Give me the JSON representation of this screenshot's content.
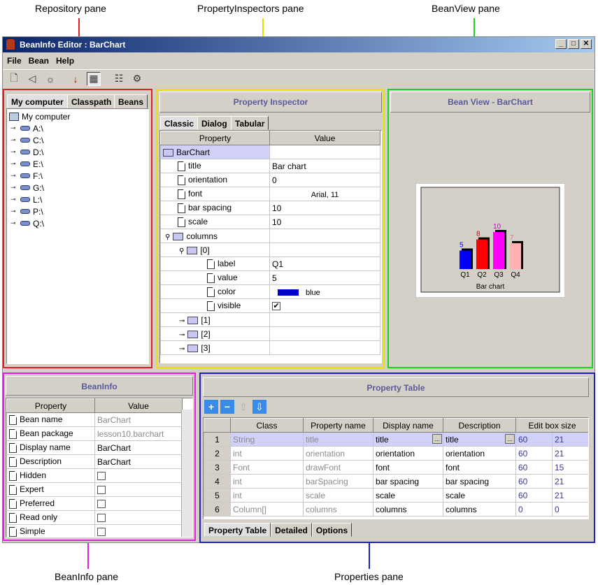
{
  "callouts": {
    "repository": "Repository pane",
    "inspectors": "PropertyInspectors pane",
    "beanview": "BeanView pane",
    "beaninfo": "BeanInfo pane",
    "properties": "Properties pane"
  },
  "window": {
    "title": "BeanInfo Editor : BarChart",
    "menu": [
      "File",
      "Bean",
      "Help"
    ]
  },
  "repository": {
    "tabs": [
      "My computer",
      "Classpath",
      "Beans"
    ],
    "root": "My computer",
    "drives": [
      "A:\\",
      "C:\\",
      "D:\\",
      "E:\\",
      "F:\\",
      "G:\\",
      "L:\\",
      "P:\\",
      "Q:\\"
    ]
  },
  "inspector": {
    "title": "Property Inspector",
    "tabs": [
      "Classic",
      "Dialog",
      "Tabular"
    ],
    "headers": [
      "Property",
      "Value"
    ],
    "root": "BarChart",
    "rows": [
      {
        "name": "title",
        "value": "Bar chart"
      },
      {
        "name": "orientation",
        "value": "0"
      },
      {
        "name": "font",
        "value": "Arial, 11"
      },
      {
        "name": "bar spacing",
        "value": "10"
      },
      {
        "name": "scale",
        "value": "10"
      }
    ],
    "columns_label": "columns",
    "item0": "[0]",
    "subrows": [
      {
        "name": "label",
        "value": "Q1"
      },
      {
        "name": "value",
        "value": "5"
      },
      {
        "name": "color",
        "value": "blue"
      },
      {
        "name": "visible",
        "value": "✔"
      }
    ],
    "items": [
      "[1]",
      "[2]",
      "[3]"
    ]
  },
  "beanview": {
    "title": "Bean View - BarChart",
    "chart_data": {
      "type": "bar",
      "title": "Bar chart",
      "categories": [
        "Q1",
        "Q2",
        "Q3",
        "Q4"
      ],
      "values": [
        5,
        8,
        10,
        7
      ],
      "colors": [
        "#0000ff",
        "#ff0000",
        "#ff00ff",
        "#ffb0b0"
      ],
      "label_colors": [
        "#0000ff",
        "#cc0000",
        "#cc00cc",
        "#e08080"
      ]
    }
  },
  "beaninfo": {
    "title": "BeanInfo",
    "headers": [
      "Property",
      "Value"
    ],
    "rows": [
      {
        "name": "Bean name",
        "value": "BarChart",
        "style": "gray"
      },
      {
        "name": "Bean package",
        "value": "lesson10.barchart",
        "style": "gray"
      },
      {
        "name": "Display name",
        "value": "BarChart",
        "style": ""
      },
      {
        "name": "Description",
        "value": "BarChart",
        "style": ""
      },
      {
        "name": "Hidden",
        "value": "",
        "style": "check"
      },
      {
        "name": "Expert",
        "value": "",
        "style": "check"
      },
      {
        "name": "Preferred",
        "value": "",
        "style": "check"
      },
      {
        "name": "Read only",
        "value": "",
        "style": "check"
      },
      {
        "name": "Simple",
        "value": "",
        "style": "check"
      }
    ]
  },
  "properties": {
    "title": "Property Table",
    "headers": [
      "Class",
      "Property name",
      "Display name",
      "Description",
      "Edit box size"
    ],
    "rows": [
      {
        "n": "1",
        "cls": "String",
        "prop": "title",
        "disp": "title",
        "desc": "title",
        "w": "60",
        "h": "21"
      },
      {
        "n": "2",
        "cls": "int",
        "prop": "orientation",
        "disp": "orientation",
        "desc": "orientation",
        "w": "60",
        "h": "21"
      },
      {
        "n": "3",
        "cls": "Font",
        "prop": "drawFont",
        "disp": "font",
        "desc": "font",
        "w": "60",
        "h": "15"
      },
      {
        "n": "4",
        "cls": "int",
        "prop": "barSpacing",
        "disp": "bar spacing",
        "desc": "bar spacing",
        "w": "60",
        "h": "21"
      },
      {
        "n": "5",
        "cls": "int",
        "prop": "scale",
        "disp": "scale",
        "desc": "scale",
        "w": "60",
        "h": "21"
      },
      {
        "n": "6",
        "cls": "Column[]",
        "prop": "columns",
        "disp": "columns",
        "desc": "columns",
        "w": "0",
        "h": "0"
      }
    ],
    "ellipsis": "...",
    "bottom_tabs": [
      "Property Table",
      "Detailed",
      "Options"
    ]
  },
  "colors": {
    "repository": "#e02020",
    "inspectors": "#f0e000",
    "beanview": "#20d020",
    "beaninfo": "#e020e0",
    "properties": "#2020c0"
  }
}
